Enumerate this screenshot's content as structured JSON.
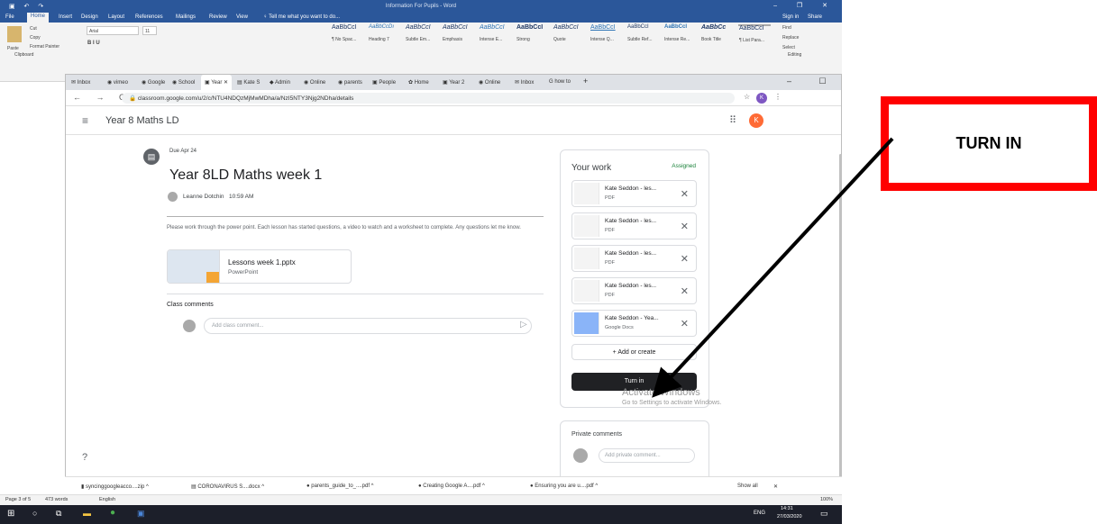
{
  "word": {
    "title": "Information For Pupils - Word",
    "tabs": [
      "File",
      "Home",
      "Insert",
      "Design",
      "Layout",
      "References",
      "Mailings",
      "Review",
      "View"
    ],
    "tellme": "Tell me what you want to do...",
    "signin": "Sign in",
    "share": "Share",
    "clipboard": {
      "paste": "Paste",
      "cut": "Cut",
      "copy": "Copy",
      "format_painter": "Format Painter",
      "label": "Clipboard"
    },
    "font_name": "Arial",
    "font_size": "11",
    "styles": [
      {
        "sample": "AaBbCcI",
        "name": "¶ No Spac..."
      },
      {
        "sample": "AaBbCcDı",
        "name": "Heading 7"
      },
      {
        "sample": "AaBbCcI",
        "name": "Subtle Em..."
      },
      {
        "sample": "AaBbCcI",
        "name": "Emphasis"
      },
      {
        "sample": "AaBbCcI",
        "name": "Intense E..."
      },
      {
        "sample": "AaBbCcI",
        "name": "Strong"
      },
      {
        "sample": "AaBbCcI",
        "name": "Quote"
      },
      {
        "sample": "AaBbCcI",
        "name": "Intense Q..."
      },
      {
        "sample": "AaBbCcI",
        "name": "Subtle Ref..."
      },
      {
        "sample": "AaBbCcI",
        "name": "Intense Re..."
      },
      {
        "sample": "AaBbCc",
        "name": "Book Title"
      },
      {
        "sample": "AaBbCcI",
        "name": "¶ List Para..."
      }
    ],
    "editing": {
      "find": "Find",
      "replace": "Replace",
      "select": "Select",
      "label": "Editing"
    },
    "status": {
      "page": "Page 3 of 5",
      "words": "473 words",
      "lang": "English",
      "zoom": "100%"
    }
  },
  "browser": {
    "tabs": [
      "Inbox",
      "vimeo",
      "Google",
      "School",
      "Year",
      "Kate S",
      "Admin",
      "Online",
      "parents",
      "People",
      "Home",
      "Year 2",
      "Online",
      "Inbox",
      "how to"
    ],
    "url": "classroom.google.com/u/2/c/NTU4NDQzMjMwMDha/a/NzI5NTY3Njg2NDha/details",
    "profile_initial": "K"
  },
  "classroom": {
    "class_name": "Year 8 Maths LD",
    "due": "Due Apr 24",
    "title": "Year 8LD Maths week 1",
    "author": "Leanne Dotchin",
    "posted_time": "10:59 AM",
    "description": "Please work through the power point. Each lesson has started questions, a video to watch and a worksheet to complete. Any questions let me know.",
    "attachment": {
      "name": "Lessons week 1.pptx",
      "type": "PowerPoint"
    },
    "class_comments_label": "Class comments",
    "class_comment_placeholder": "Add class comment...",
    "your_work": {
      "heading": "Your work",
      "status": "Assigned",
      "files": [
        {
          "name": "Kate Seddon - les...",
          "type": "PDF"
        },
        {
          "name": "Kate Seddon - les...",
          "type": "PDF"
        },
        {
          "name": "Kate Seddon - les...",
          "type": "PDF"
        },
        {
          "name": "Kate Seddon - les...",
          "type": "PDF"
        },
        {
          "name": "Kate Seddon - Yea...",
          "type": "Google Docs"
        }
      ],
      "add_or_create": "Add or create",
      "turn_in": "Turn in"
    },
    "private_comments_label": "Private comments",
    "private_comment_placeholder": "Add private comment..."
  },
  "activate": {
    "title": "Activate Windows",
    "subtitle": "Go to Settings to activate Windows."
  },
  "downloads": {
    "items": [
      "syncinggoogleacco....zip",
      "CORONAVIRUS S....docx",
      "parents_guide_to_....pdf",
      "Creating Google A....pdf",
      "Ensuring you are u....pdf"
    ],
    "show_all": "Show all"
  },
  "taskbar": {
    "lang": "ENG",
    "time": "14:31",
    "date": "27/03/2020"
  },
  "callout": {
    "text": "TURN IN"
  },
  "colors": {
    "word_blue": "#2b579a",
    "callout_red": "#ff0000",
    "assigned_green": "#188038",
    "avatar_orange": "#ff6b36"
  }
}
